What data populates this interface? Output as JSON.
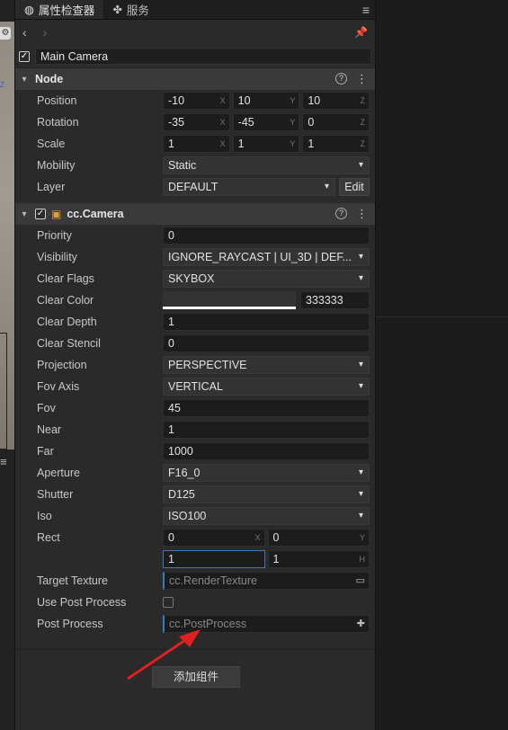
{
  "tabs": [
    {
      "label": "属性检查器"
    },
    {
      "label": "服务"
    }
  ],
  "node_name": "Main Camera",
  "node_section": {
    "title": "Node",
    "position": {
      "label": "Position",
      "x": "-10",
      "y": "10",
      "z": "10"
    },
    "rotation": {
      "label": "Rotation",
      "x": "-35",
      "y": "-45",
      "z": "0"
    },
    "scale": {
      "label": "Scale",
      "x": "1",
      "y": "1",
      "z": "1"
    },
    "mobility": {
      "label": "Mobility",
      "value": "Static"
    },
    "layer": {
      "label": "Layer",
      "value": "DEFAULT",
      "edit": "Edit"
    }
  },
  "camera_section": {
    "title": "cc.Camera",
    "priority": {
      "label": "Priority",
      "value": "0"
    },
    "visibility": {
      "label": "Visibility",
      "value": "IGNORE_RAYCAST | UI_3D | DEF..."
    },
    "clear_flags": {
      "label": "Clear Flags",
      "value": "SKYBOX"
    },
    "clear_color": {
      "label": "Clear Color",
      "hex": "333333",
      "swatch": "#ffffff"
    },
    "clear_depth": {
      "label": "Clear Depth",
      "value": "1"
    },
    "clear_stencil": {
      "label": "Clear Stencil",
      "value": "0"
    },
    "projection": {
      "label": "Projection",
      "value": "PERSPECTIVE"
    },
    "fov_axis": {
      "label": "Fov Axis",
      "value": "VERTICAL"
    },
    "fov": {
      "label": "Fov",
      "value": "45"
    },
    "near": {
      "label": "Near",
      "value": "1"
    },
    "far": {
      "label": "Far",
      "value": "1000"
    },
    "aperture": {
      "label": "Aperture",
      "value": "F16_0"
    },
    "shutter": {
      "label": "Shutter",
      "value": "D125"
    },
    "iso": {
      "label": "Iso",
      "value": "ISO100"
    },
    "rect": {
      "label": "Rect",
      "x": "0",
      "y": "0",
      "w": "1",
      "h": "1"
    },
    "target_texture": {
      "label": "Target Texture",
      "placeholder": "cc.RenderTexture"
    },
    "use_post_process": {
      "label": "Use Post Process",
      "checked": false
    },
    "post_process": {
      "label": "Post Process",
      "placeholder": "cc.PostProcess"
    }
  },
  "axis_labels": {
    "x": "X",
    "y": "Y",
    "z": "Z",
    "h": "H"
  },
  "add_component": "添加组件",
  "colors": {
    "accent": "#3a7bbf",
    "annotation_arrow": "#e02020"
  }
}
